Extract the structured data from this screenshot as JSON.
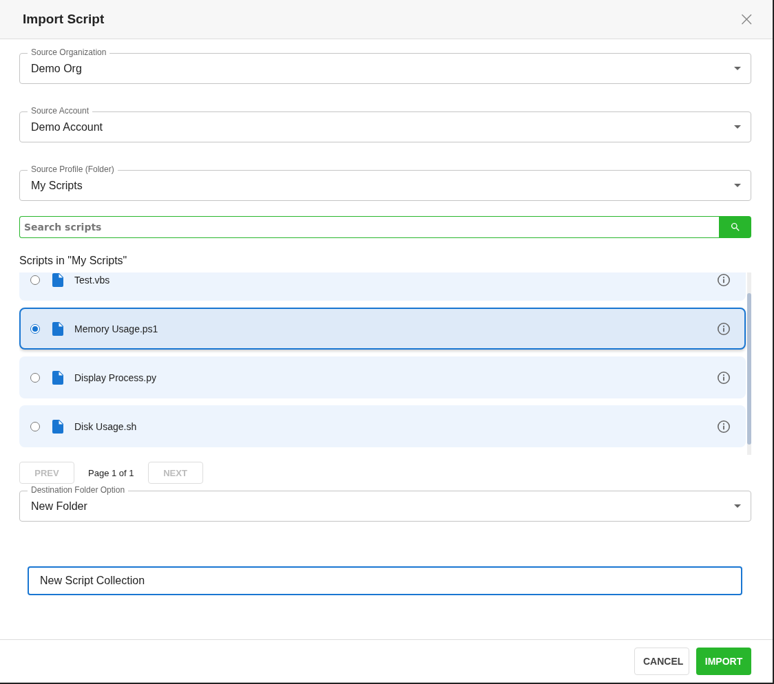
{
  "dialog": {
    "title": "Import Script",
    "close_label": "×"
  },
  "selects": [
    {
      "label": "Source Organization",
      "value": "Demo Org"
    },
    {
      "label": "Source Account",
      "value": "Demo Account"
    },
    {
      "label": "Source Profile (Folder)",
      "value": "My Scripts"
    }
  ],
  "search": {
    "placeholder": "Search scripts"
  },
  "list_heading": "Scripts in \"My Scripts\"",
  "scripts": [
    {
      "name": "Test.vbs",
      "selected": false
    },
    {
      "name": "Memory Usage.ps1",
      "selected": true
    },
    {
      "name": "Display Process.py",
      "selected": false
    },
    {
      "name": "Disk Usage.sh",
      "selected": false
    }
  ],
  "pager": {
    "prev": {
      "label": "PREV",
      "disabled": true
    },
    "page": "Page 1 of 1",
    "next": {
      "label": "NEXT",
      "disabled": true
    }
  },
  "destination": {
    "label": "Destination Folder Option",
    "value": "New Folder"
  },
  "folder_name": {
    "value": "New Script Collection"
  },
  "buttons": [
    {
      "label": "CANCEL",
      "kind": "secondary"
    },
    {
      "label": "IMPORT",
      "kind": "primary"
    }
  ]
}
